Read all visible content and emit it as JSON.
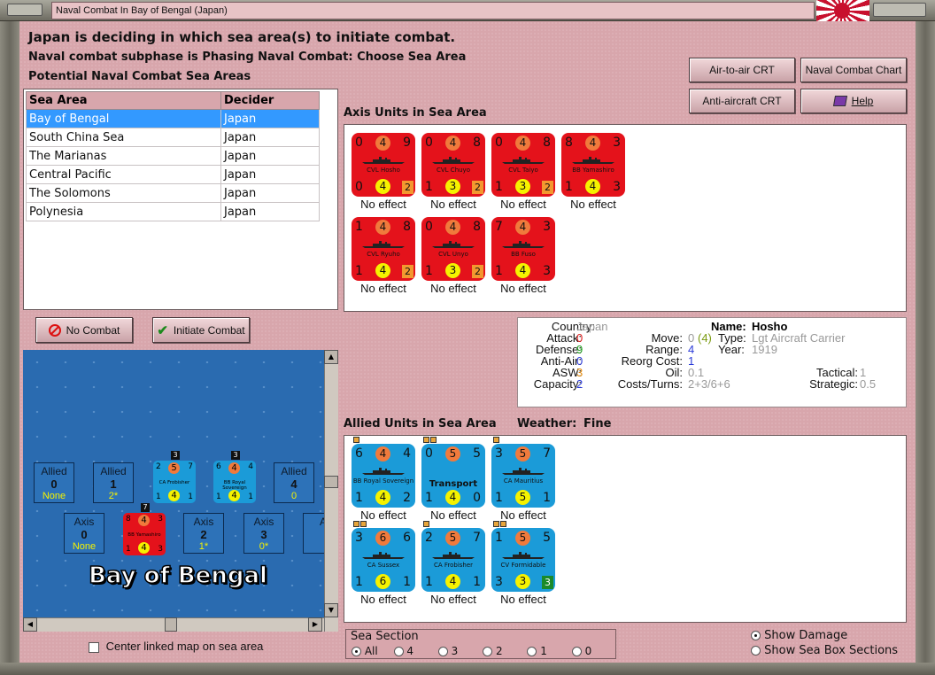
{
  "window": {
    "title": "Naval Combat In Bay of Bengal (Japan)"
  },
  "status": {
    "line1": "Japan is deciding in which sea area(s) to initiate combat.",
    "line2": "Naval combat subphase is Phasing Naval Combat: Choose Sea Area",
    "line3": "Potential Naval Combat Sea Areas"
  },
  "buttons": {
    "air_to_air": "Air-to-air CRT",
    "naval_chart": "Naval Combat Chart",
    "anti_aircraft": "Anti-aircraft CRT",
    "help": "Help",
    "no_combat": "No Combat",
    "initiate_combat": "Initiate Combat"
  },
  "sea_table": {
    "headers": [
      "Sea Area",
      "Decider"
    ],
    "rows": [
      [
        "Bay of Bengal",
        "Japan"
      ],
      [
        "South China Sea",
        "Japan"
      ],
      [
        "The Marianas",
        "Japan"
      ],
      [
        "Central Pacific",
        "Japan"
      ],
      [
        "The Solomons",
        "Japan"
      ],
      [
        "Polynesia",
        "Japan"
      ]
    ]
  },
  "axis_title": "Axis Units in Sea Area",
  "allied_title": "Allied Units in Sea Area",
  "weather_label": "Weather:",
  "weather_value": "Fine",
  "axis_units": [
    {
      "tl": "0",
      "atk": "4",
      "tr": "9",
      "name": "CVL Hosho",
      "bl": "0",
      "def": "4",
      "badge": "2",
      "effect": "No effect"
    },
    {
      "tl": "0",
      "atk": "4",
      "tr": "8",
      "name": "CVL Chuyo",
      "bl": "1",
      "def": "3",
      "badge": "2",
      "effect": "No effect"
    },
    {
      "tl": "0",
      "atk": "4",
      "tr": "8",
      "name": "CVL Taiyo",
      "bl": "1",
      "def": "3",
      "badge": "2",
      "effect": "No effect"
    },
    {
      "tl": "8",
      "atk": "4",
      "tr": "3",
      "name": "BB Yamashiro",
      "bl": "1",
      "def": "4",
      "br": "3",
      "effect": "No effect"
    },
    {
      "tl": "1",
      "atk": "4",
      "tr": "8",
      "name": "CVL Ryuho",
      "bl": "1",
      "def": "4",
      "badge": "2",
      "effect": "No effect"
    },
    {
      "tl": "0",
      "atk": "4",
      "tr": "8",
      "name": "CVL Unyo",
      "bl": "1",
      "def": "3",
      "badge": "2",
      "effect": "No effect"
    },
    {
      "tl": "7",
      "atk": "4",
      "tr": "3",
      "name": "BB Fuso",
      "bl": "1",
      "def": "4",
      "br": "3",
      "effect": "No effect"
    }
  ],
  "allied_units": [
    {
      "tl": "6",
      "atk": "4",
      "tr": "4",
      "name": "BB Royal Sovereign",
      "bl": "1",
      "def": "4",
      "br": "2",
      "effect": "No effect"
    },
    {
      "tl": "0",
      "atk": "5",
      "tr": "5",
      "name": "Transport",
      "bl": "1",
      "def": "4",
      "br": "0",
      "effect": "No effect",
      "big": true
    },
    {
      "tl": "3",
      "atk": "5",
      "tr": "7",
      "name": "CA Mauritius",
      "bl": "1",
      "def": "5",
      "br": "1",
      "effect": "No effect"
    },
    {
      "tl": "3",
      "atk": "6",
      "tr": "6",
      "name": "CA Sussex",
      "bl": "1",
      "def": "6",
      "br": "1",
      "effect": "No effect"
    },
    {
      "tl": "2",
      "atk": "5",
      "tr": "7",
      "name": "CA Frobisher",
      "bl": "1",
      "def": "4",
      "br": "1",
      "effect": "No effect"
    },
    {
      "tl": "1",
      "atk": "5",
      "tr": "5",
      "name": "CV Formidable",
      "bl": "3",
      "def": "3",
      "badge": "3",
      "badge_green": true,
      "effect": "No effect"
    }
  ],
  "info": {
    "country_label": "Country:",
    "country": "Japan",
    "attack_label": "Attack:",
    "attack": "0",
    "defense_label": "Defense:",
    "defense": "9",
    "anti_air_label": "Anti-Air:",
    "anti_air": "0",
    "asw_label": "ASW:",
    "asw": "3",
    "capacity_label": "Capacity:",
    "capacity": "2",
    "name_label": "Name:",
    "name": "Hosho",
    "move_label": "Move:",
    "move": "0",
    "move_extra": "(4)",
    "type_label": "Type:",
    "type": "Lgt Aircraft Carrier",
    "range_label": "Range:",
    "range": "4",
    "year_label": "Year:",
    "year": "1919",
    "reorg_label": "Reorg Cost:",
    "reorg": "1",
    "oil_label": "Oil:",
    "oil": "0.1",
    "costs_label": "Costs/Turns:",
    "costs": "2+3/6+6",
    "tactical_label": "Tactical:",
    "tactical": "1",
    "strategic_label": "Strategic:",
    "strategic": "0.5"
  },
  "map": {
    "sea_name": "Bay of Bengal",
    "allied_boxes": [
      {
        "title": "Allied",
        "num": "0",
        "sub": "None"
      },
      {
        "title": "Allied",
        "num": "1",
        "sub": "2*"
      },
      {
        "title": "Allied",
        "num": "4",
        "sub": "0"
      }
    ],
    "axis_boxes": [
      {
        "title": "Axis",
        "num": "0",
        "sub": "None"
      },
      {
        "title": "Axis",
        "num": "2",
        "sub": "1*"
      },
      {
        "title": "Axis",
        "num": "3",
        "sub": "0*"
      },
      {
        "title": "A",
        "num": "",
        "sub": ""
      }
    ],
    "mini_frobisher": {
      "tl": "2",
      "atk": "5",
      "tr": "7",
      "name": "CA Frobisher",
      "bl": "1",
      "def": "4",
      "br": "1",
      "stack": "3"
    },
    "mini_royal": {
      "tl": "6",
      "atk": "4",
      "tr": "4",
      "name": "BB Royal Sovereign",
      "bl": "1",
      "def": "4",
      "br": "1",
      "stack": "3"
    },
    "mini_yamashiro": {
      "tl": "8",
      "atk": "4",
      "tr": "3",
      "name": "BB Yamashiro",
      "bl": "1",
      "def": "4",
      "br": "3",
      "stack": "7"
    }
  },
  "center_checkbox": "Center linked map on sea area",
  "sea_section": {
    "title": "Sea Section",
    "options": [
      "All",
      "4",
      "3",
      "2",
      "1",
      "0"
    ],
    "selected": "All"
  },
  "display_options": {
    "show_damage": "Show Damage",
    "show_sections": "Show Sea Box Sections",
    "selected": "Show Damage"
  },
  "colors": {
    "background": "#d8a6ac",
    "axis_counter": "#e4121b",
    "allied_counter": "#1b9bd8",
    "selection": "#3399ff",
    "sea": "#2a6bb0"
  }
}
